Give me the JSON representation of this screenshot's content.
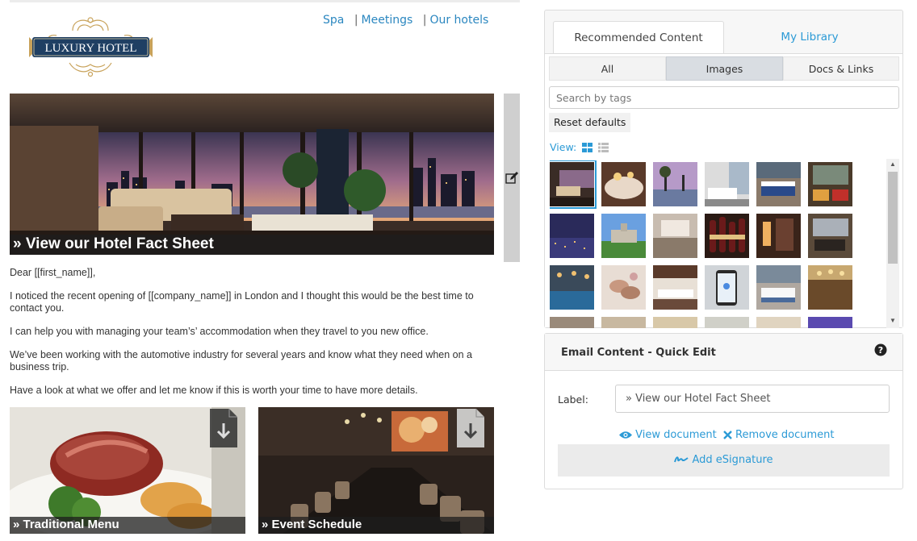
{
  "email": {
    "logo_text": "LUXURY HOTEL",
    "nav": [
      {
        "label": "Spa"
      },
      {
        "label": "Meetings"
      },
      {
        "label": "Our hotels"
      }
    ],
    "nav_separator": "|",
    "hero_caption": "» View our Hotel Fact Sheet",
    "paragraphs": [
      "Dear [[first_name]],",
      "I noticed the recent opening of [[company_name]] in London and I thought this would be the best time to contact you.",
      "I can help you with managing your team’s’ accommodation when they travel to you new office.",
      "We’ve been working with the automotive industry for several years and know what they need when on a business trip.",
      "Have a look at what we offer and let me know if this is worth your time to have more details."
    ],
    "tiles": [
      {
        "caption": "» Traditional Menu"
      },
      {
        "caption": "» Event Schedule"
      }
    ]
  },
  "content_panel": {
    "tabs": [
      {
        "label": "Recommended Content",
        "active": true
      },
      {
        "label": "My Library",
        "active": false
      }
    ],
    "filters": [
      {
        "label": "All",
        "active": false
      },
      {
        "label": "Images",
        "active": true
      },
      {
        "label": "Docs & Links",
        "active": false
      }
    ],
    "search_placeholder": "Search by tags",
    "reset_label": "Reset defaults",
    "view_label": "View:",
    "view_modes": [
      "grid-view-icon",
      "list-view-icon"
    ]
  },
  "quick_edit": {
    "title": "Email Content - Quick Edit",
    "label_caption": "Label:",
    "label_value": "» View our Hotel Fact Sheet",
    "view_document": "View document",
    "remove_document": "Remove document",
    "add_esignature": "Add eSignature"
  },
  "colors": {
    "link_blue": "#2b9ad6",
    "nav_blue": "#2b87c0",
    "logo_navy": "#1f3f63",
    "logo_gold": "#c8a25a",
    "caption_overlay": "#1e1e1e"
  }
}
